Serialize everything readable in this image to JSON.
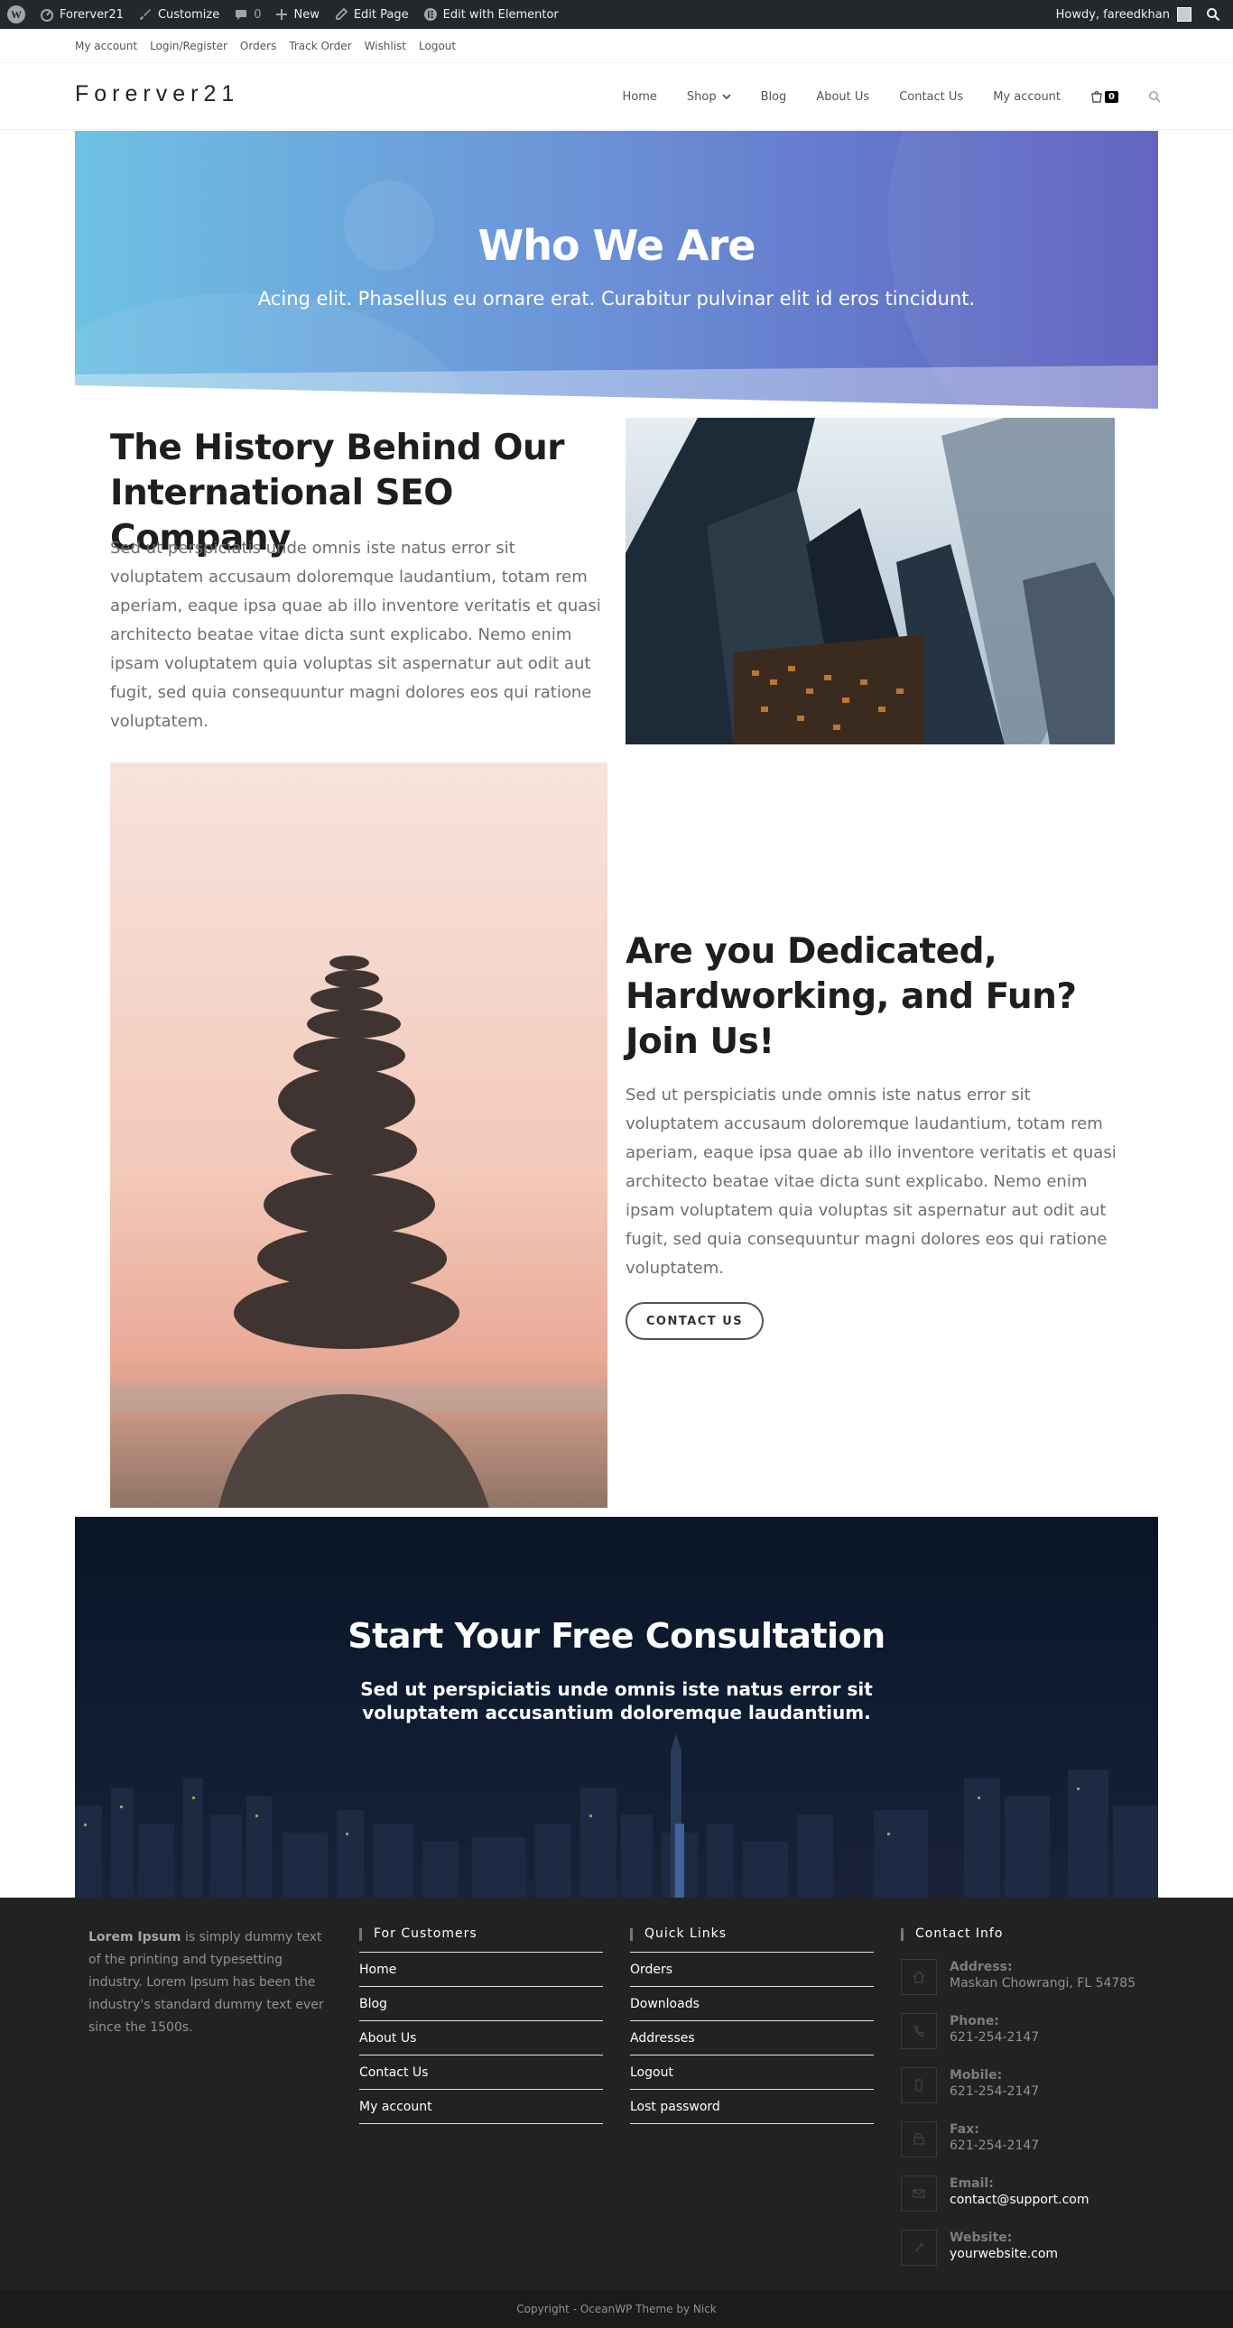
{
  "adminbar": {
    "site_name": "Forerver21",
    "customize": "Customize",
    "comments": "0",
    "new": "New",
    "edit_page": "Edit Page",
    "edit_elementor": "Edit with Elementor",
    "howdy": "Howdy, fareedkhan"
  },
  "topbar": {
    "links": [
      "My account",
      "Login/Register",
      "Orders",
      "Track Order",
      "Wishlist",
      "Logout"
    ]
  },
  "header": {
    "logo": "Forerver21",
    "nav": [
      "Home",
      "Shop",
      "Blog",
      "About Us",
      "Contact Us",
      "My account"
    ],
    "cart_count": "0"
  },
  "hero": {
    "title": "Who We Are",
    "subtitle": "Acing elit. Phasellus eu ornare erat. Curabitur pulvinar elit id eros tincidunt."
  },
  "history": {
    "title": "The History Behind Our International SEO Company",
    "text": "Sed ut perspiciatis unde omnis iste natus error sit voluptatem accusaum doloremque laudantium, totam rem aperiam, eaque ipsa quae ab illo inventore veritatis et quasi architecto beatae vitae dicta sunt explicabo. Nemo enim ipsam voluptatem quia voluptas sit aspernatur aut odit aut fugit, sed quia consequuntur magni dolores eos qui ratione voluptatem."
  },
  "dedicated": {
    "title": "Are you Dedicated, Hardworking, and Fun? Join Us!",
    "text": "Sed ut perspiciatis unde omnis iste natus error sit voluptatem accusaum doloremque laudantium, totam rem aperiam, eaque ipsa quae ab illo inventore veritatis et quasi architecto beatae vitae dicta sunt explicabo. Nemo enim ipsam voluptatem quia voluptas sit aspernatur aut odit aut fugit, sed quia consequuntur magni dolores eos qui ratione voluptatem.",
    "button": "CONTACT US"
  },
  "consult": {
    "title": "Start Your Free Consultation",
    "subtitle": "Sed ut perspiciatis unde omnis iste natus error sit voluptatem accusantium doloremque laudantium."
  },
  "footer": {
    "about_bold": "Lorem Ipsum",
    "about_text": " is simply dummy text of the printing and typesetting industry. Lorem Ipsum has been the industry's standard dummy text ever since the 1500s.",
    "customers_heading": "For Customers",
    "customers_links": [
      "Home",
      "Blog",
      "About Us",
      "Contact Us",
      "My account"
    ],
    "quick_heading": "Quick Links",
    "quick_links": [
      "Orders",
      "Downloads",
      "Addresses",
      "Logout",
      "Lost password"
    ],
    "contact_heading": "Contact Info",
    "contact": [
      {
        "label": "Address:",
        "value": "Maskan Chowrangi, FL 54785",
        "icon": "home-icon"
      },
      {
        "label": "Phone:",
        "value": "621-254-2147",
        "icon": "phone-icon"
      },
      {
        "label": "Mobile:",
        "value": "621-254-2147",
        "icon": "mobile-icon"
      },
      {
        "label": "Fax:",
        "value": "621-254-2147",
        "icon": "fax-icon"
      },
      {
        "label": "Email:",
        "value": "contact@support.com",
        "icon": "email-icon"
      },
      {
        "label": "Website:",
        "value": "yourwebsite.com",
        "icon": "link-icon"
      }
    ],
    "copyright": "Copyright - OceanWP Theme by Nick"
  }
}
